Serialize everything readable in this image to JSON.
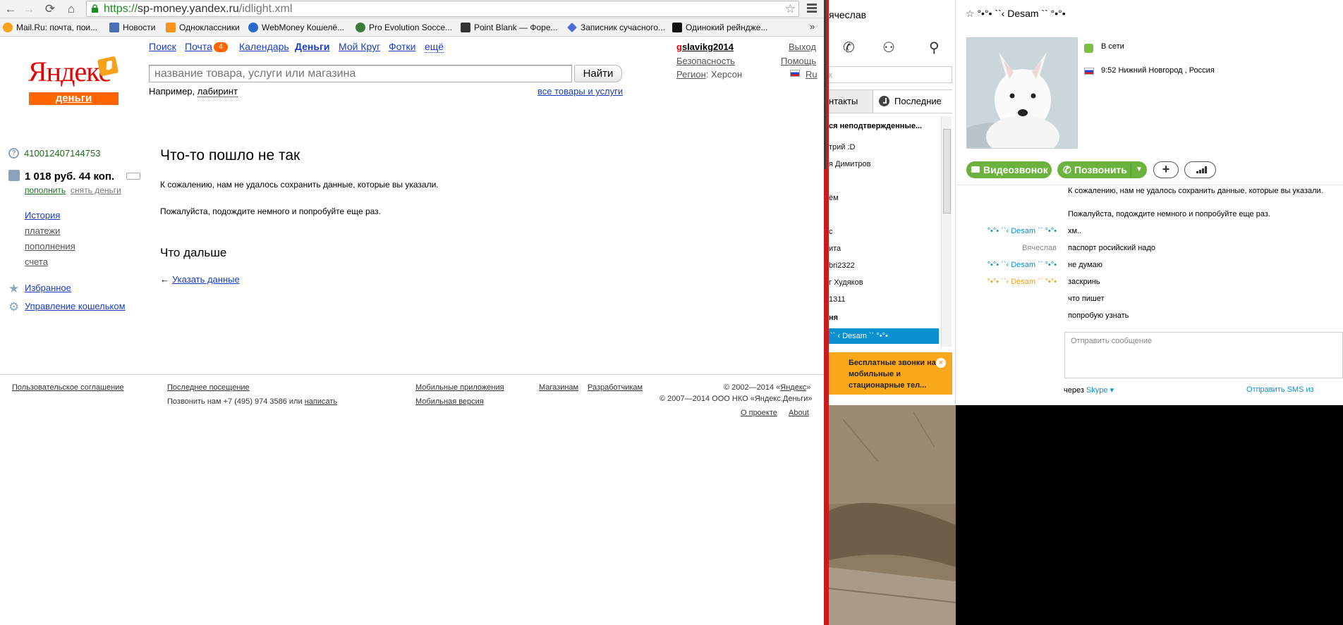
{
  "browser": {
    "url_scheme": "https://",
    "url_host": "sp-money.yandex.ru",
    "url_path": "/idlight.xml",
    "bookmarks": [
      {
        "label": "Mail.Ru: почта, пои...",
        "icon": "mailru-icon",
        "color": "#f7a21a"
      },
      {
        "label": "Новости",
        "icon": "b-icon",
        "color": "#4a6fb5"
      },
      {
        "label": "Одноклассники",
        "icon": "odnoklassniki-icon",
        "color": "#f7931e"
      },
      {
        "label": "WebMoney Кошелё...",
        "icon": "globe-icon",
        "color": "#2a6ac9"
      },
      {
        "label": "Pro Evolution Socce...",
        "icon": "ball-icon",
        "color": "#3a7d3a"
      },
      {
        "label": "Point Blank — Форе...",
        "icon": "pb-icon",
        "color": "#333333"
      },
      {
        "label": "Записник сучасного...",
        "icon": "diamond-icon",
        "color": "#4f6bd8"
      },
      {
        "label": "Одинокий рейндже...",
        "icon": "hd-icon",
        "color": "#111111"
      }
    ],
    "bookmarks_more": "»"
  },
  "yandex": {
    "logo_word": "Яндекс",
    "logo_sub": "деньги",
    "nav": {
      "search": "Поиск",
      "mail": "Почта",
      "mail_count": "4",
      "calendar": "Календарь",
      "money": "Деньги",
      "mykrug": "Мой Круг",
      "photos": "Фотки",
      "more": "ещё"
    },
    "search_placeholder": "название товара, услуги или магазина",
    "search_button": "Найти",
    "example_prefix": "Например,",
    "example_link": "лабиринт",
    "all_goods": "все товары и услуги",
    "user_first": "g",
    "user_rest": "slavikg2014",
    "logout": "Выход",
    "security": "Безопасность",
    "help": "Помощь",
    "region_label": "Регион",
    "region_value": ": Херсон",
    "lang": "Ru",
    "sidebar": {
      "wallet_number": "410012407144753",
      "balance": "1 018 руб. 44 коп.",
      "topup": "пополнить",
      "withdraw": "снять деньги",
      "history": "История",
      "payments": "платежи",
      "replenishments": "пополнения",
      "bills": "счета",
      "favorites": "Избранное",
      "wallet_manage": "Управление кошельком"
    },
    "error_title": "Что-то пошло не так",
    "error_text1": "К сожалению, нам не удалось сохранить данные, которые вы указали.",
    "error_text2": "Пожалуйста, подождите немного и попробуйте еще раз.",
    "next_title": "Что дальше",
    "back_arrow": "←",
    "specify_link": "Указать данные",
    "footer": {
      "agreement": "Пользовательское соглашение",
      "last_visit": "Последнее посещение",
      "call_prefix": "Позвонить нам +7 (495) 974 3586 или",
      "write": "написать",
      "mobile_apps": "Мобильные приложения",
      "mobile_version": "Мобильная версия",
      "shops": "Магазинам",
      "developers": "Разработчикам",
      "copy1_prefix": "© 2002—2014 «",
      "copy1_link": "Яндекс",
      "copy1_suffix": "»",
      "copy2": "© 2007—2014 ООО НКО «Яндекс.Деньги»",
      "about_ru": "О проекте",
      "about_en": "About"
    }
  },
  "skype": {
    "contact_panel_name": "ячеслав",
    "search_stub": "к",
    "tab_contacts": "нтакты",
    "tab_recent": "Последние",
    "list_header": "ся неподтвержденные...",
    "contacts": [
      "трий :D",
      "я Димитров",
      "",
      "ём",
      "",
      "с",
      "ита",
      "bri2322",
      "г Худяков",
      "1311",
      "ня"
    ],
    "selected_contact": "`` ‹ Desam `` °•°•",
    "promo": "Бесплатные звонки на мобильные и стационарные тел...",
    "promo_close": "×",
    "conv_name": "°•°• ``‹ Desam `` °•°•",
    "status": "В сети",
    "local_time": "9:52 Нижний Новгород , Россия",
    "btn_video": "Видеозвонок",
    "btn_call": "Позвонить",
    "btn_add": "+",
    "messages": [
      {
        "name": "",
        "name_color": "#888888",
        "text": "К сожалению, нам не удалось сохранить данные, которые вы указали."
      },
      {
        "name": "",
        "name_color": "#888888",
        "text": "Пожалуйста, подождите немного и попробуйте еще раз."
      },
      {
        "name": "°•°• ``‹ Desam `` °•°•",
        "name_color": "#0b91d2",
        "text": "хм.."
      },
      {
        "name": "Вячеслав",
        "name_color": "#888888",
        "text": "паспорт росийский надо"
      },
      {
        "name": "°•°• ``‹ Desam `` °•°•",
        "name_color": "#0b91d2",
        "text": "не думаю"
      },
      {
        "name": "°•°• ``‹ Desam `` °•°•",
        "name_color": "#f39c12",
        "text": "заскринь"
      },
      {
        "name": "",
        "name_color": "#888888",
        "text": "что пишет"
      },
      {
        "name": "",
        "name_color": "#888888",
        "text": "попробую узнать"
      }
    ],
    "compose_placeholder": "Отправить сообщение",
    "via_prefix": "через",
    "via_link": "Skype ▾",
    "send_sms": "Отправить SMS из"
  }
}
